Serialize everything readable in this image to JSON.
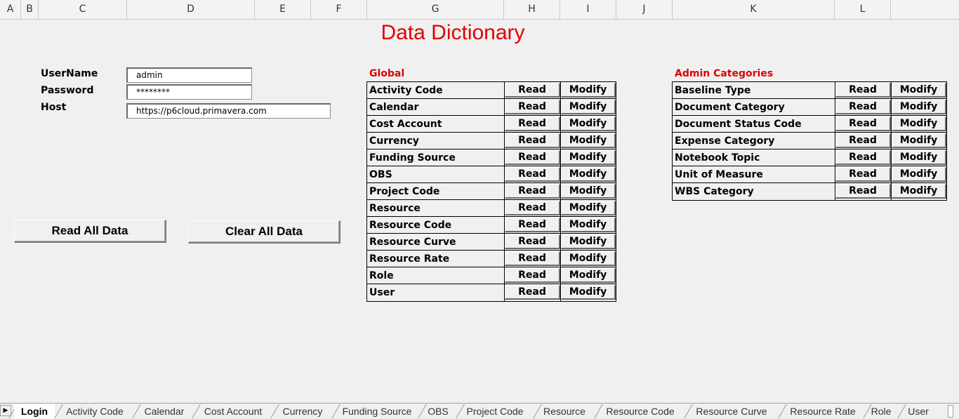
{
  "columns": [
    "A",
    "B",
    "C",
    "D",
    "E",
    "F",
    "G",
    "H",
    "I",
    "J",
    "K",
    "L"
  ],
  "title": "Data Dictionary",
  "login": {
    "username_label": "UserName",
    "password_label": "Password",
    "host_label": "Host",
    "username_value": "admin",
    "password_value": "********",
    "host_value": "https://p6cloud.primavera.com"
  },
  "buttons": {
    "read_all": "Read All Data",
    "clear_all": "Clear All Data"
  },
  "global": {
    "heading": "Global",
    "read_label": "Read",
    "modify_label": "Modify",
    "items": [
      "Activity Code",
      "Calendar",
      "Cost Account",
      "Currency",
      "Funding Source",
      "OBS",
      "Project Code",
      "Resource",
      "Resource Code",
      "Resource Curve",
      "Resource Rate",
      "Role",
      "User"
    ]
  },
  "admin": {
    "heading": "Admin Categories",
    "read_label": "Read",
    "modify_label": "Modify",
    "items": [
      "Baseline Type",
      "Document Category",
      "Document Status Code",
      "Expense Category",
      "Notebook Topic",
      "Unit of Measure",
      "WBS Category"
    ]
  },
  "sheet_tabs": [
    "Login",
    "Activity Code",
    "Calendar",
    "Cost Account",
    "Currency",
    "Funding Source",
    "OBS",
    "Project Code",
    "Resource",
    "Resource Code",
    "Resource Curve",
    "Resource Rate",
    "Role",
    "User"
  ],
  "active_tab": "Login",
  "colors": {
    "title": "#e00000",
    "section_heading": "#e00000"
  }
}
